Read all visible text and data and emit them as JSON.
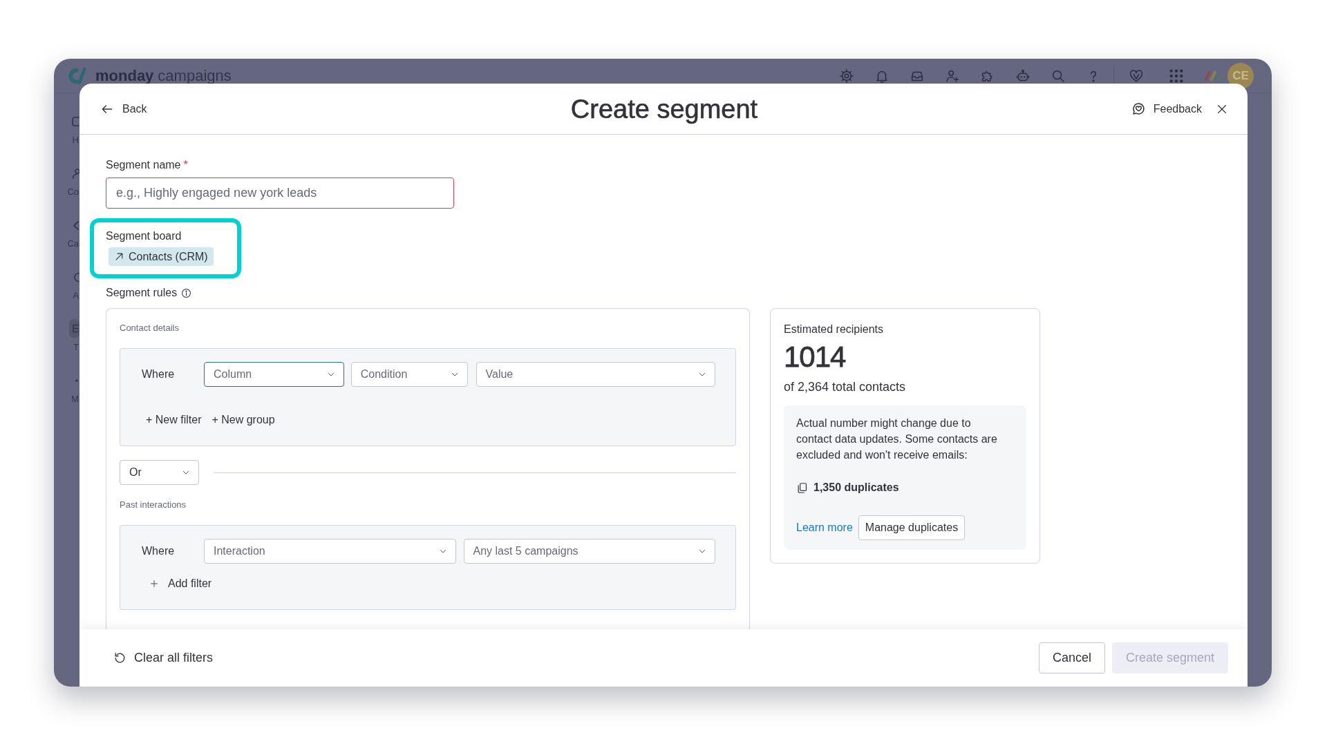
{
  "app": {
    "brand": "monday",
    "product": "campaigns",
    "avatar": "CE",
    "sidebar": [
      {
        "label": "H",
        "selected": false
      },
      {
        "label": "Co",
        "selected": false
      },
      {
        "label": "Ca",
        "selected": false
      },
      {
        "label": "A",
        "selected": false
      },
      {
        "label": "T",
        "selected": true
      },
      {
        "label": "M",
        "selected": false
      }
    ]
  },
  "dialog": {
    "back": "Back",
    "title": "Create segment",
    "feedback": "Feedback",
    "segment_name": {
      "label": "Segment name",
      "required_mark": "*",
      "placeholder": "e.g., Highly engaged new york leads",
      "invalid": true
    },
    "segment_board": {
      "label": "Segment board",
      "value": "Contacts (CRM)",
      "highlighted": true
    },
    "segment_rules": {
      "label": "Segment rules",
      "sections": [
        {
          "title": "Contact details",
          "rows": [
            {
              "label": "Where",
              "dropdowns": [
                {
                  "text": "Column",
                  "focused": true,
                  "greyed": true
                },
                {
                  "text": "Condition",
                  "focused": false,
                  "greyed": true
                },
                {
                  "text": "Value",
                  "focused": false,
                  "greyed": true
                }
              ]
            }
          ],
          "actions": [
            {
              "kind": "text",
              "label": "+ New filter"
            },
            {
              "kind": "text",
              "label": "+ New group"
            }
          ]
        },
        {
          "operator": {
            "text": "Or",
            "focused": false,
            "greyed": false
          },
          "title": "Past interactions",
          "rows": [
            {
              "label": "Where",
              "dropdowns": [
                {
                  "text": "Interaction",
                  "focused": false,
                  "greyed": true
                },
                {
                  "text": "Any last 5 campaigns",
                  "focused": false,
                  "greyed": true
                }
              ]
            }
          ],
          "actions": [
            {
              "kind": "icon",
              "label": "Add filter"
            }
          ]
        }
      ]
    },
    "estimate": {
      "title": "Estimated recipients",
      "count": "1014",
      "total": "of 2,364 total contacts",
      "note": "Actual number might change due to contact data updates. Some contacts are excluded and won't receive emails:",
      "duplicates": "1,350 duplicates",
      "link": "Learn more",
      "button": "Manage duplicates"
    },
    "footer": {
      "reset": "Clear all filters",
      "buttons": [
        {
          "label": "Cancel",
          "kind": "secondary",
          "disabled": false
        },
        {
          "label": "Create segment",
          "kind": "primary",
          "disabled": true
        }
      ]
    }
  }
}
